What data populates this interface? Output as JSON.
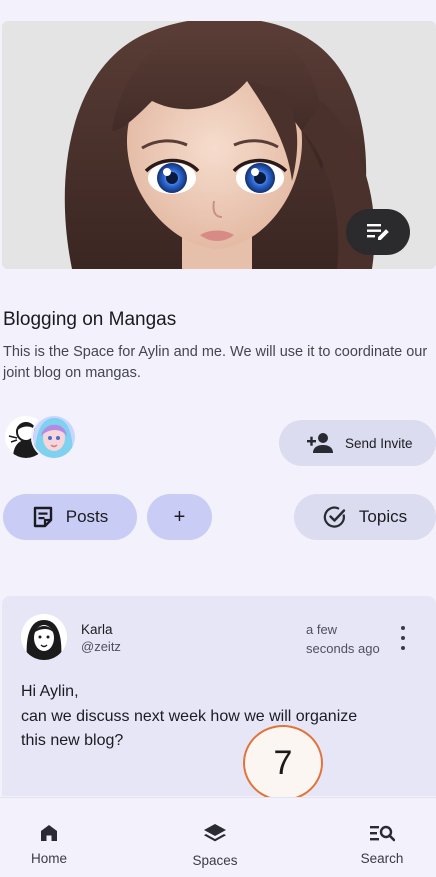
{
  "space": {
    "title": "Blogging on Mangas",
    "description": "This is the Space for Aylin and me. We will use it to coordinate our joint blog on mangas."
  },
  "actions": {
    "invite_label": "Send Invite",
    "posts_label": "Posts",
    "add_label": "+",
    "topics_label": "Topics"
  },
  "post": {
    "author_name": "Karla",
    "author_handle": "@zeitz",
    "time_line1": "a few",
    "time_line2": "seconds ago",
    "body_line1": "Hi Aylin,",
    "body_line2": "can we discuss next week how we will organize",
    "body_line3": "this new blog?"
  },
  "badge": {
    "number": "7",
    "border_color": "#e0743b"
  },
  "nav": {
    "home_label": "Home",
    "spaces_label": "Spaces",
    "search_label": "Search"
  },
  "icons": {
    "edit": "edit-note-icon",
    "invite": "person-add-icon",
    "posts": "posts-icon",
    "topics": "check-circle-icon",
    "more": "more-vert-icon",
    "home": "home-icon",
    "spaces": "layers-icon",
    "search": "search-list-icon"
  },
  "colors": {
    "background": "#f3f1fb",
    "primary_pill": "#c9cdf6",
    "secondary_pill": "#dcdcf0",
    "card": "#e6e6f6"
  }
}
